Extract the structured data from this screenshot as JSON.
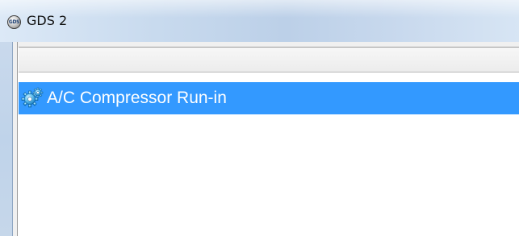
{
  "window": {
    "title": "GDS 2",
    "icon_name": "gds-app-icon",
    "icon_text": "GDS"
  },
  "list": {
    "items": [
      {
        "label": "A/C Compressor Run-in",
        "icon": "gears-icon",
        "selected": true
      }
    ]
  },
  "colors": {
    "selection": "#3399ff",
    "selection_text": "#ffffff"
  }
}
